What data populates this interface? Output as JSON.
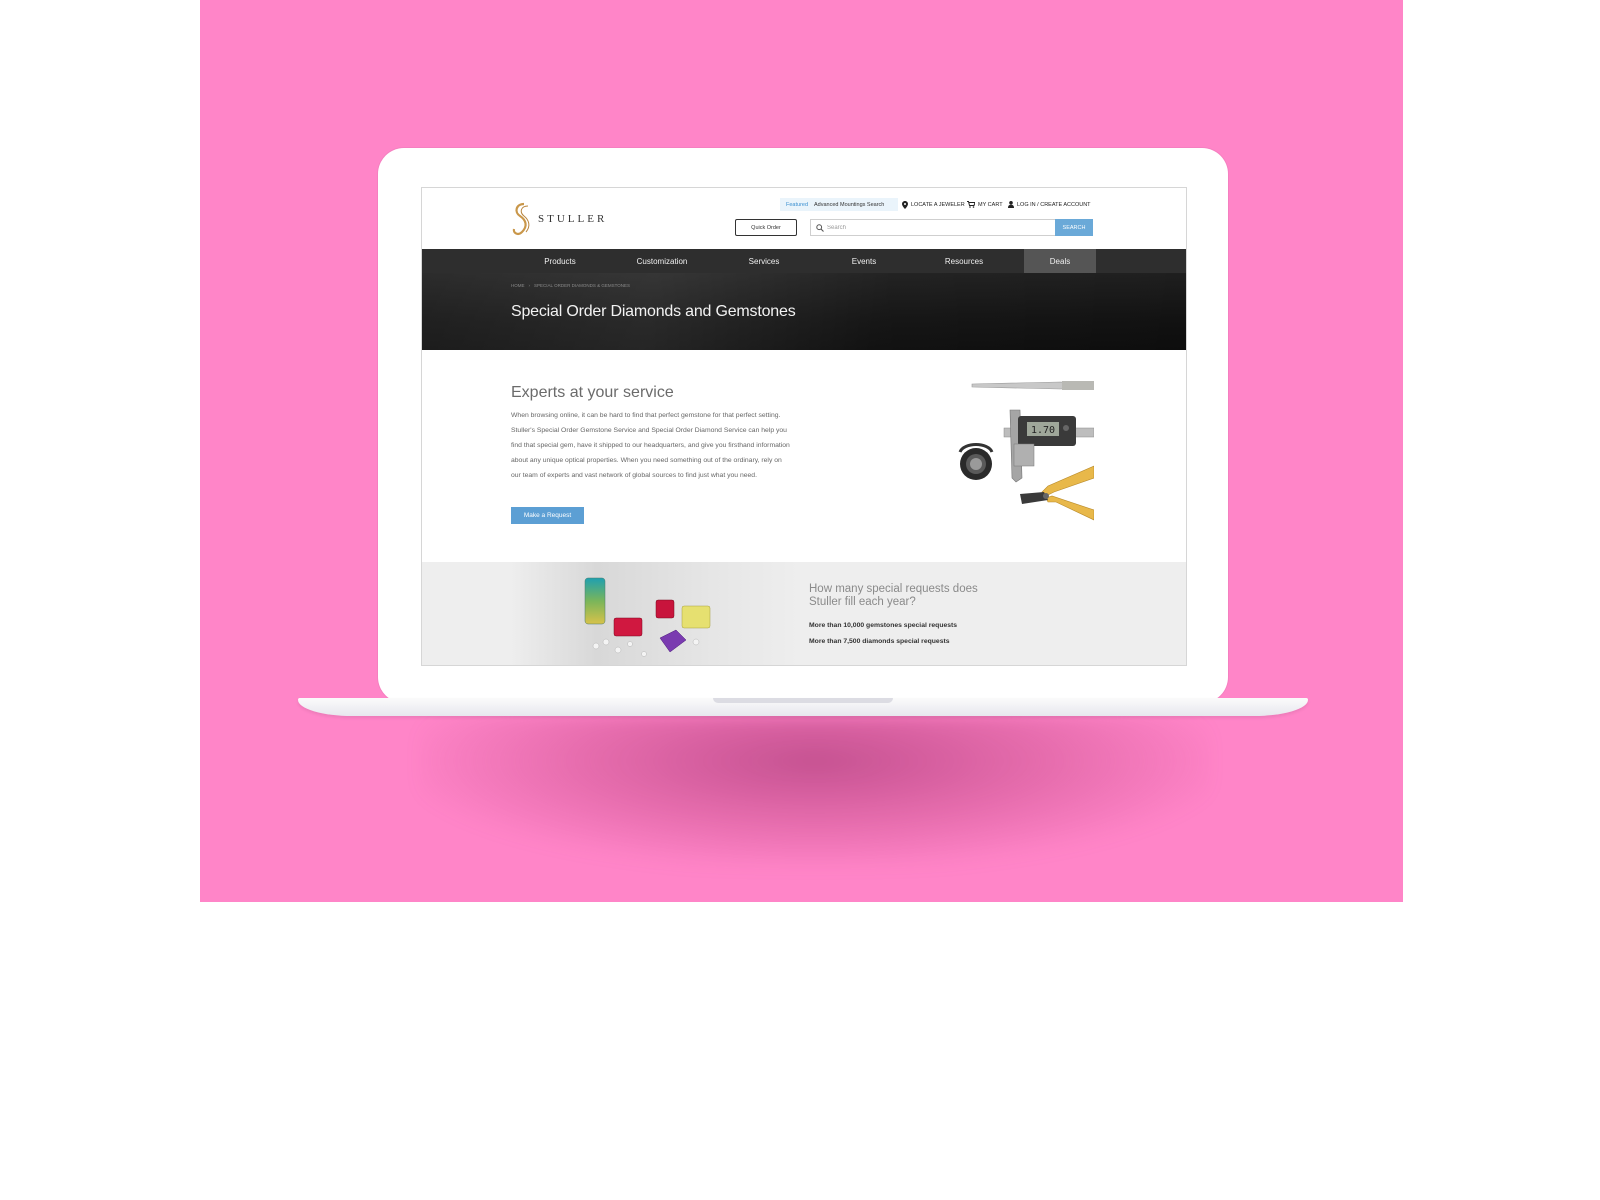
{
  "colors": {
    "background_pink": "#ff85c8",
    "nav_bar": "#2e2e2e",
    "accent_blue": "#5c9fd4",
    "logo_gold": "#c9974a"
  },
  "header": {
    "logo_text": "STULLER",
    "featured_tag": "Featured",
    "featured_link": "Advanced Mountings Search",
    "locate_jeweler": "LOCATE A JEWELER",
    "my_cart": "MY CART",
    "login": "LOG IN / CREATE ACCOUNT",
    "quick_order": "Quick Order",
    "search_placeholder": "Search",
    "search_button": "SEARCH"
  },
  "nav": {
    "items": [
      {
        "label": "Products"
      },
      {
        "label": "Customization"
      },
      {
        "label": "Services"
      },
      {
        "label": "Events"
      },
      {
        "label": "Resources"
      },
      {
        "label": "Deals"
      }
    ]
  },
  "hero": {
    "breadcrumb_home": "HOME",
    "breadcrumb_current": "SPECIAL ORDER DIAMONDS & GEMSTONES",
    "title": "Special Order Diamonds and Gemstones"
  },
  "content": {
    "heading": "Experts at your service",
    "body": "When browsing online, it can be hard to find that perfect gemstone for that perfect setting. Stuller's Special Order Gemstone Service and Special Order Diamond Service can help you find that special gem, have it shipped to our headquarters, and give you firsthand information about any unique optical properties. When you need something out of the ordinary, rely on our team of experts and vast network of global sources to find just what you need.",
    "button": "Make a Request",
    "caliper_reading": "1.70"
  },
  "band": {
    "question": "How many special requests does Stuller fill each year?",
    "stat1": "More than 10,000 gemstones special requests",
    "stat2": "More than 7,500 diamonds special requests"
  }
}
